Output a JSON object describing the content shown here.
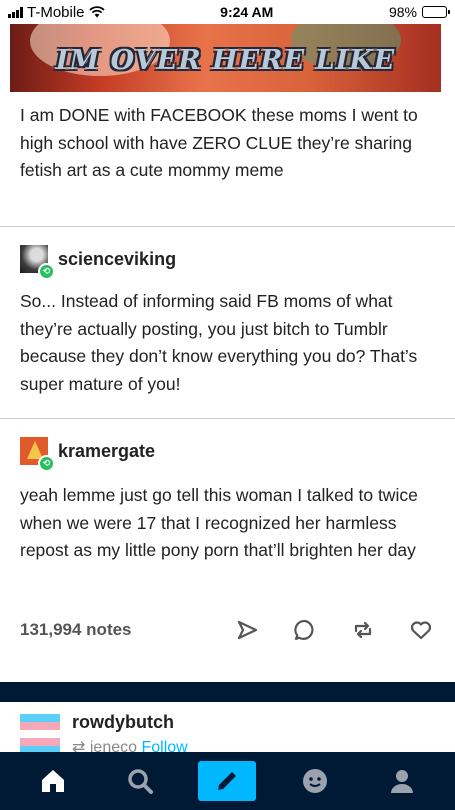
{
  "status_bar": {
    "carrier": "T-Mobile",
    "time": "9:24 AM",
    "battery": "98%",
    "battery_level": 0.98
  },
  "meme": {
    "caption": "IM OVER HERE LIKE"
  },
  "original_post": {
    "text": "I am DONE with FACEBOOK these moms I went to high school with have ZERO CLUE they’re sharing fetish art as a cute mommy meme"
  },
  "reblogs": [
    {
      "username": "scienceviking",
      "text": "So... Instead of informing said FB moms of what they’re actually posting, you just bitch to Tumblr because they don’t know everything you do? That’s super mature of you!"
    },
    {
      "username": "kramergate",
      "text": "yeah lemme just go tell this woman I talked to twice when we were 17 that I recognized her harmless repost as my little pony porn that’ll brighten her day"
    }
  ],
  "footer": {
    "notes": "131,994 notes",
    "icons": [
      "share-icon",
      "reply-icon",
      "reblog-icon",
      "like-icon"
    ]
  },
  "next_post": {
    "username": "rowdybutch",
    "reblogged_from": "ieneco",
    "follow_label": "Follow"
  },
  "tab_bar": {
    "tabs": [
      "home-icon",
      "search-icon",
      "compose-icon",
      "activity-icon",
      "account-icon"
    ]
  },
  "colors": {
    "navy": "#001935",
    "accent": "#00b8ff",
    "reblog_green": "#26c15f"
  }
}
